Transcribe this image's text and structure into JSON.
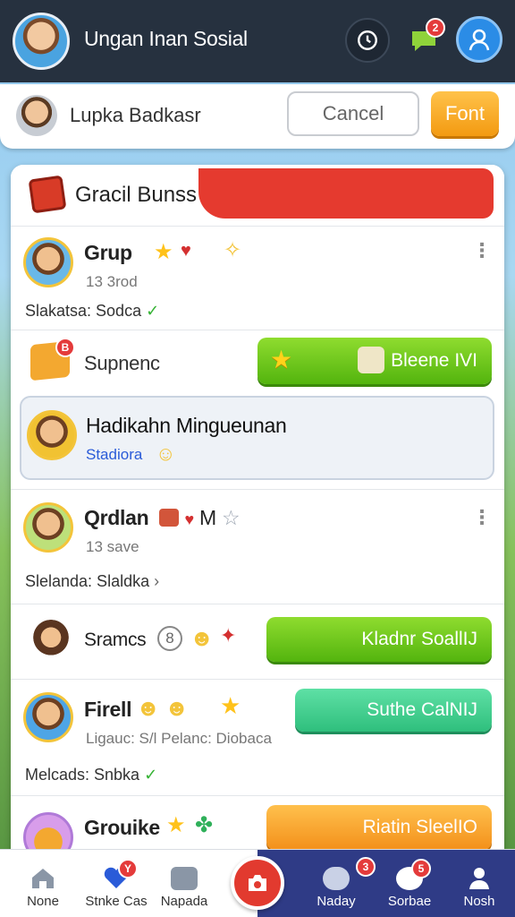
{
  "topbar": {
    "title": "Ungan Inan Sosial",
    "chat_badge": "2"
  },
  "subbar": {
    "name": "Lupka Badkasr",
    "cancel_label": "Cancel",
    "font_label": "Font"
  },
  "panel": {
    "header_title": "Gracil Bunss"
  },
  "rows": [
    {
      "name": "Grup",
      "sub": "13 3rod",
      "status": "Slakatsa: Sodca",
      "status_mark": "✓"
    },
    {
      "name": "Supnenc",
      "button": "Bleene IVI"
    },
    {
      "name": "Hadikahn Mingueunan",
      "sub": "Stadiora"
    },
    {
      "name": "Qrdlan",
      "suffix": "M",
      "sub": "13 save",
      "status": "Slelanda: Slaldka",
      "status_mark": "›"
    },
    {
      "name": "Sramcs",
      "badge": "8",
      "button": "Kladnr SoallIJ"
    },
    {
      "name": "Firell",
      "sub": "Ligauc: S/l Pelanc: Diobaca",
      "button": "Suthe CalNIJ",
      "status": "Melcads: Snbka",
      "status_mark": "✓"
    },
    {
      "name": "Grouike",
      "button": "Riatin SleelIO"
    }
  ],
  "bottomnav": {
    "items": [
      {
        "label": "None",
        "icon": "home-icon"
      },
      {
        "label": "Stnke Cas",
        "icon": "heart-icon",
        "badge": "Y"
      },
      {
        "label": "Napada",
        "icon": "group-icon"
      },
      {
        "label": "Naday",
        "icon": "cloud-icon",
        "badge": "3"
      },
      {
        "label": "Sorbae",
        "icon": "refresh-icon",
        "badge": "5"
      },
      {
        "label": "Nosh",
        "icon": "person-icon"
      }
    ]
  },
  "colors": {
    "topbar": "#26313f",
    "accent_red": "#e53a2f",
    "green": "#53b40e",
    "orange": "#f3901b",
    "teal": "#2fbf7d",
    "blue_nav": "#2f3b86"
  }
}
